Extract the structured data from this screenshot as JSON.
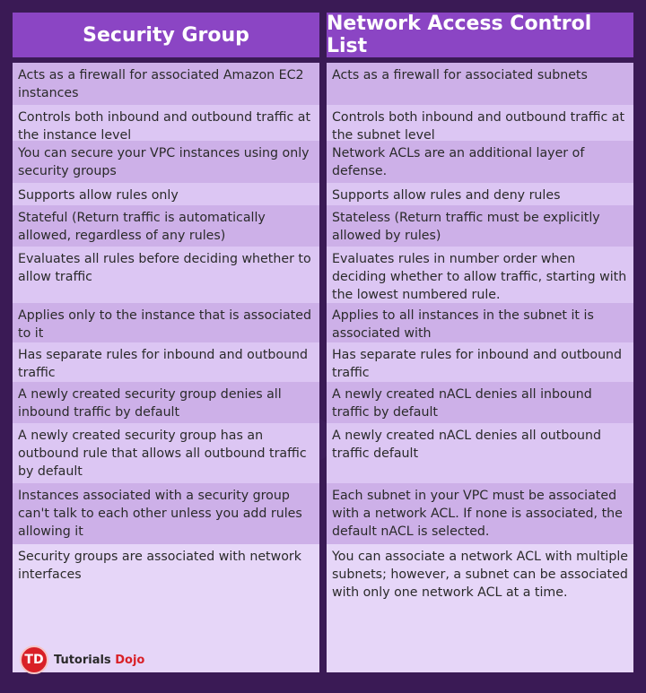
{
  "headers": {
    "left": "Security Group",
    "right": "Network Access Control List"
  },
  "rows": [
    {
      "left": "Acts as a firewall for associated Amazon EC2 instances",
      "right": "Acts as a firewall for associated subnets"
    },
    {
      "left": "Controls both inbound and outbound traffic at the instance level",
      "right": "Controls both inbound and outbound traffic at the subnet level"
    },
    {
      "left": "You can secure your VPC instances using only security groups",
      "right": "Network ACLs are an additional layer of defense."
    },
    {
      "left": "Supports allow rules only",
      "right": "Supports allow rules and deny rules"
    },
    {
      "left": "Stateful (Return traffic is automatically allowed, regardless of any rules)",
      "right": "Stateless (Return traffic must be explicitly allowed by rules)"
    },
    {
      "left": "Evaluates all rules before deciding whether to allow traffic",
      "right": "Evaluates rules in number order when deciding whether to allow traffic, starting with the lowest numbered rule."
    },
    {
      "left": "Applies only to the instance that is associated to it",
      "right": "Applies to all instances in the subnet it is associated with"
    },
    {
      "left": "Has separate rules for inbound and outbound traffic",
      "right": "Has separate rules for inbound and outbound traffic"
    },
    {
      "left": "A newly created security group denies all inbound traffic by default",
      "right": "A newly created nACL denies all inbound traffic by default"
    },
    {
      "left": "A newly created security group has an outbound rule that allows all outbound traffic by default",
      "right": "A newly created nACL denies all outbound traffic default"
    },
    {
      "left": "Instances associated with a security group can't talk to each other unless you add rules allowing it",
      "right": "Each subnet in your VPC must be associated with a network ACL. If none is associated, the default nACL is selected."
    },
    {
      "left": "Security groups are associated with network interfaces",
      "right": "You can associate a network ACL with multiple subnets; however, a subnet can be associated with only one network ACL at a time."
    }
  ],
  "watermark": "Tutorials Dojo",
  "logo": {
    "badge": "TD",
    "name": "Tutorials",
    "accent": "Dojo"
  },
  "colors": {
    "background": "#3a1a55",
    "header": "#8b45c4",
    "row_odd": "#cdb0e8",
    "row_even": "#dcc6f3",
    "logo_red": "#d92027"
  }
}
